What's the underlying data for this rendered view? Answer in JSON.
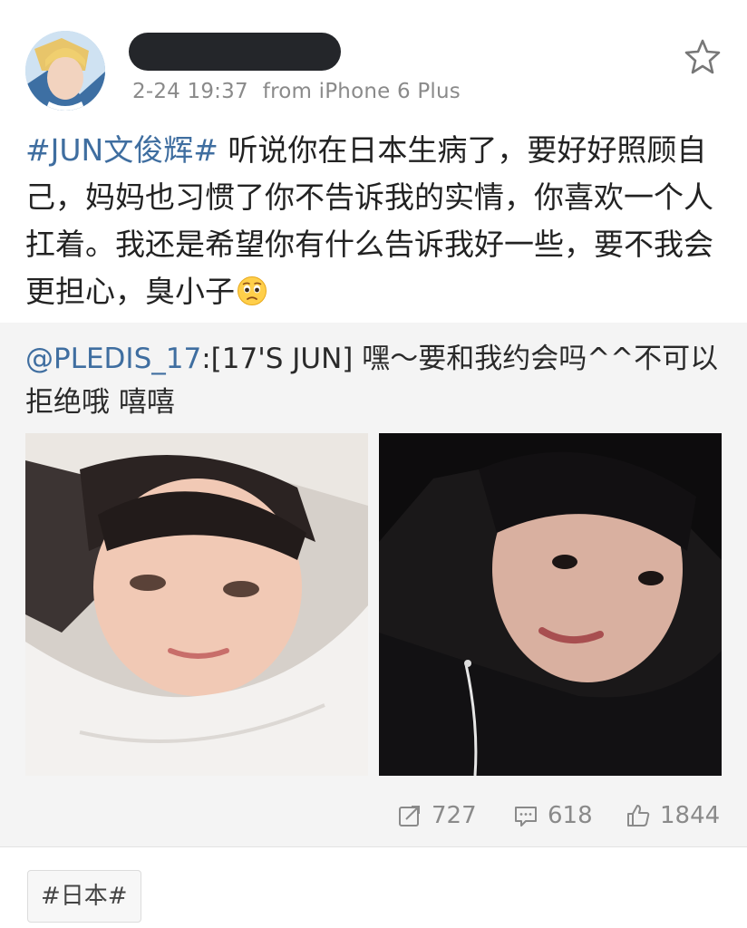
{
  "post": {
    "timestamp": "2-24 19:37",
    "source": "from iPhone 6 Plus",
    "hashtag": "#JUN文俊辉#",
    "body": " 听说你在日本生病了，要好好照顾自己，妈妈也习惯了你不告诉我的实情，你喜欢一个人扛着。我还是希望你有什么告诉我好一些，要不我会更担心，臭小子"
  },
  "repost": {
    "mention": "@PLEDIS_17",
    "text": ":[17'S JUN] 嘿～要和我约会吗^^不可以拒绝哦 嘻嘻"
  },
  "actions": {
    "reposts": "727",
    "comments": "618",
    "likes": "1844"
  },
  "topic": {
    "label": "#日本#"
  },
  "icons": {
    "favorite": "star-icon",
    "emoji": "pleading-face-emoji-icon",
    "repost": "repost-icon",
    "comment": "comment-icon",
    "like": "thumbs-up-icon"
  },
  "colors": {
    "link": "#3f6ea0",
    "meta_text": "#8a8a8a",
    "repost_bg": "#f4f4f4"
  }
}
